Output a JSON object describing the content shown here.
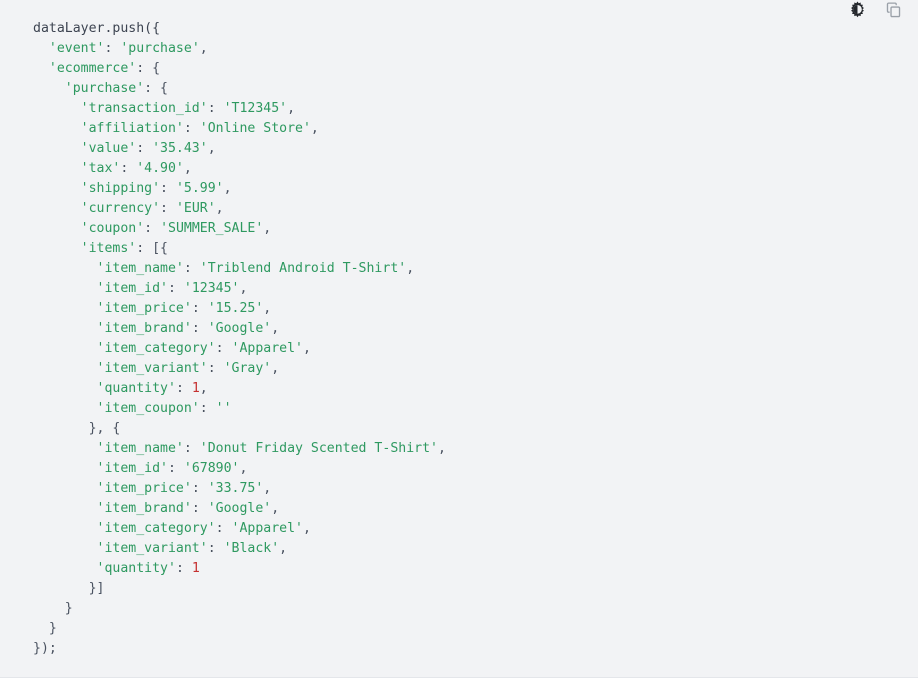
{
  "toolbar": {
    "theme_toggle_label": "Toggle light/dark theme",
    "theme_toggle_icon": "brightness-icon",
    "copy_label": "Copy code",
    "copy_icon": "copy-icon"
  },
  "colors": {
    "background": "#f2f3f5",
    "string": "#2e9960",
    "number": "#c53030",
    "punctuation": "#4a5260",
    "identifier": "#3d4451",
    "toolbar_icon_dark": "#23262b",
    "toolbar_icon_gray": "#9aa0a8"
  },
  "code": {
    "language": "javascript",
    "lines": [
      {
        "indent": 0,
        "tokens": [
          {
            "t": "id",
            "v": "dataLayer.push({"
          }
        ]
      },
      {
        "indent": 1,
        "tokens": [
          {
            "t": "str",
            "v": "'event'"
          },
          {
            "t": "pun",
            "v": ": "
          },
          {
            "t": "str",
            "v": "'purchase'"
          },
          {
            "t": "pun",
            "v": ","
          }
        ]
      },
      {
        "indent": 1,
        "tokens": [
          {
            "t": "str",
            "v": "'ecommerce'"
          },
          {
            "t": "pun",
            "v": ": {"
          }
        ]
      },
      {
        "indent": 2,
        "tokens": [
          {
            "t": "str",
            "v": "'purchase'"
          },
          {
            "t": "pun",
            "v": ": {"
          }
        ]
      },
      {
        "indent": 3,
        "tokens": [
          {
            "t": "str",
            "v": "'transaction_id'"
          },
          {
            "t": "pun",
            "v": ": "
          },
          {
            "t": "str",
            "v": "'T12345'"
          },
          {
            "t": "pun",
            "v": ","
          }
        ]
      },
      {
        "indent": 3,
        "tokens": [
          {
            "t": "str",
            "v": "'affiliation'"
          },
          {
            "t": "pun",
            "v": ": "
          },
          {
            "t": "str",
            "v": "'Online Store'"
          },
          {
            "t": "pun",
            "v": ","
          }
        ]
      },
      {
        "indent": 3,
        "tokens": [
          {
            "t": "str",
            "v": "'value'"
          },
          {
            "t": "pun",
            "v": ": "
          },
          {
            "t": "str",
            "v": "'35.43'"
          },
          {
            "t": "pun",
            "v": ","
          }
        ]
      },
      {
        "indent": 3,
        "tokens": [
          {
            "t": "str",
            "v": "'tax'"
          },
          {
            "t": "pun",
            "v": ": "
          },
          {
            "t": "str",
            "v": "'4.90'"
          },
          {
            "t": "pun",
            "v": ","
          }
        ]
      },
      {
        "indent": 3,
        "tokens": [
          {
            "t": "str",
            "v": "'shipping'"
          },
          {
            "t": "pun",
            "v": ": "
          },
          {
            "t": "str",
            "v": "'5.99'"
          },
          {
            "t": "pun",
            "v": ","
          }
        ]
      },
      {
        "indent": 3,
        "tokens": [
          {
            "t": "str",
            "v": "'currency'"
          },
          {
            "t": "pun",
            "v": ": "
          },
          {
            "t": "str",
            "v": "'EUR'"
          },
          {
            "t": "pun",
            "v": ","
          }
        ]
      },
      {
        "indent": 3,
        "tokens": [
          {
            "t": "str",
            "v": "'coupon'"
          },
          {
            "t": "pun",
            "v": ": "
          },
          {
            "t": "str",
            "v": "'SUMMER_SALE'"
          },
          {
            "t": "pun",
            "v": ","
          }
        ]
      },
      {
        "indent": 3,
        "tokens": [
          {
            "t": "str",
            "v": "'items'"
          },
          {
            "t": "pun",
            "v": ": [{"
          }
        ]
      },
      {
        "indent": 4,
        "tokens": [
          {
            "t": "str",
            "v": "'item_name'"
          },
          {
            "t": "pun",
            "v": ": "
          },
          {
            "t": "str",
            "v": "'Triblend Android T-Shirt'"
          },
          {
            "t": "pun",
            "v": ","
          }
        ]
      },
      {
        "indent": 4,
        "tokens": [
          {
            "t": "str",
            "v": "'item_id'"
          },
          {
            "t": "pun",
            "v": ": "
          },
          {
            "t": "str",
            "v": "'12345'"
          },
          {
            "t": "pun",
            "v": ","
          }
        ]
      },
      {
        "indent": 4,
        "tokens": [
          {
            "t": "str",
            "v": "'item_price'"
          },
          {
            "t": "pun",
            "v": ": "
          },
          {
            "t": "str",
            "v": "'15.25'"
          },
          {
            "t": "pun",
            "v": ","
          }
        ]
      },
      {
        "indent": 4,
        "tokens": [
          {
            "t": "str",
            "v": "'item_brand'"
          },
          {
            "t": "pun",
            "v": ": "
          },
          {
            "t": "str",
            "v": "'Google'"
          },
          {
            "t": "pun",
            "v": ","
          }
        ]
      },
      {
        "indent": 4,
        "tokens": [
          {
            "t": "str",
            "v": "'item_category'"
          },
          {
            "t": "pun",
            "v": ": "
          },
          {
            "t": "str",
            "v": "'Apparel'"
          },
          {
            "t": "pun",
            "v": ","
          }
        ]
      },
      {
        "indent": 4,
        "tokens": [
          {
            "t": "str",
            "v": "'item_variant'"
          },
          {
            "t": "pun",
            "v": ": "
          },
          {
            "t": "str",
            "v": "'Gray'"
          },
          {
            "t": "pun",
            "v": ","
          }
        ]
      },
      {
        "indent": 4,
        "tokens": [
          {
            "t": "str",
            "v": "'quantity'"
          },
          {
            "t": "pun",
            "v": ": "
          },
          {
            "t": "num",
            "v": "1"
          },
          {
            "t": "pun",
            "v": ","
          }
        ]
      },
      {
        "indent": 4,
        "tokens": [
          {
            "t": "str",
            "v": "'item_coupon'"
          },
          {
            "t": "pun",
            "v": ": "
          },
          {
            "t": "str",
            "v": "''"
          }
        ]
      },
      {
        "indent": 3,
        "tokens": [
          {
            "t": "pun",
            "v": "}, {"
          }
        ],
        "halfdedent": true
      },
      {
        "indent": 4,
        "tokens": [
          {
            "t": "str",
            "v": "'item_name'"
          },
          {
            "t": "pun",
            "v": ": "
          },
          {
            "t": "str",
            "v": "'Donut Friday Scented T-Shirt'"
          },
          {
            "t": "pun",
            "v": ","
          }
        ]
      },
      {
        "indent": 4,
        "tokens": [
          {
            "t": "str",
            "v": "'item_id'"
          },
          {
            "t": "pun",
            "v": ": "
          },
          {
            "t": "str",
            "v": "'67890'"
          },
          {
            "t": "pun",
            "v": ","
          }
        ]
      },
      {
        "indent": 4,
        "tokens": [
          {
            "t": "str",
            "v": "'item_price'"
          },
          {
            "t": "pun",
            "v": ": "
          },
          {
            "t": "str",
            "v": "'33.75'"
          },
          {
            "t": "pun",
            "v": ","
          }
        ]
      },
      {
        "indent": 4,
        "tokens": [
          {
            "t": "str",
            "v": "'item_brand'"
          },
          {
            "t": "pun",
            "v": ": "
          },
          {
            "t": "str",
            "v": "'Google'"
          },
          {
            "t": "pun",
            "v": ","
          }
        ]
      },
      {
        "indent": 4,
        "tokens": [
          {
            "t": "str",
            "v": "'item_category'"
          },
          {
            "t": "pun",
            "v": ": "
          },
          {
            "t": "str",
            "v": "'Apparel'"
          },
          {
            "t": "pun",
            "v": ","
          }
        ]
      },
      {
        "indent": 4,
        "tokens": [
          {
            "t": "str",
            "v": "'item_variant'"
          },
          {
            "t": "pun",
            "v": ": "
          },
          {
            "t": "str",
            "v": "'Black'"
          },
          {
            "t": "pun",
            "v": ","
          }
        ]
      },
      {
        "indent": 4,
        "tokens": [
          {
            "t": "str",
            "v": "'quantity'"
          },
          {
            "t": "pun",
            "v": ": "
          },
          {
            "t": "num",
            "v": "1"
          }
        ]
      },
      {
        "indent": 3,
        "tokens": [
          {
            "t": "pun",
            "v": "}]"
          }
        ],
        "halfdedent": true
      },
      {
        "indent": 2,
        "tokens": [
          {
            "t": "pun",
            "v": "}"
          }
        ]
      },
      {
        "indent": 1,
        "tokens": [
          {
            "t": "pun",
            "v": "}"
          }
        ]
      },
      {
        "indent": 0,
        "tokens": [
          {
            "t": "pun",
            "v": "});"
          }
        ]
      }
    ]
  }
}
